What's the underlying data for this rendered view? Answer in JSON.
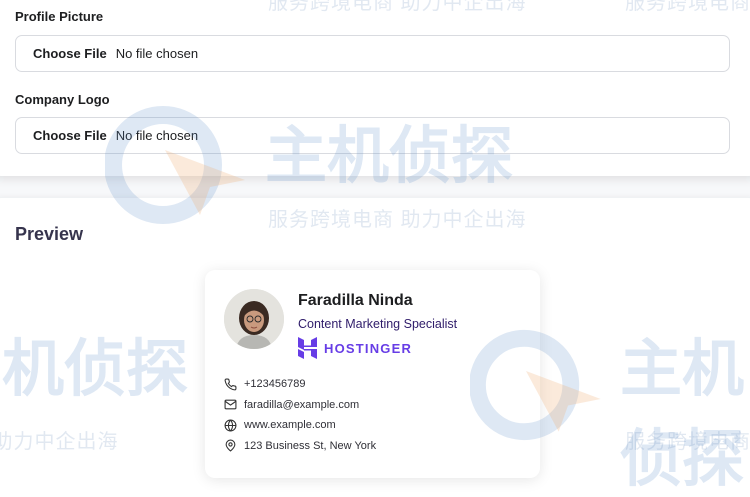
{
  "form": {
    "profile_picture": {
      "label": "Profile Picture",
      "button": "Choose File",
      "status": "No file chosen"
    },
    "company_logo": {
      "label": "Company Logo",
      "button": "Choose File",
      "status": "No file chosen"
    }
  },
  "preview": {
    "title": "Preview",
    "signature": {
      "name": "Faradilla Ninda",
      "role": "Content Marketing Specialist",
      "company": "HOSTINGER",
      "brand_color": "#673de6",
      "contacts": [
        {
          "icon": "phone-icon",
          "text": "+123456789"
        },
        {
          "icon": "mail-icon",
          "text": "faradilla@example.com"
        },
        {
          "icon": "globe-icon",
          "text": "www.example.com"
        },
        {
          "icon": "location-pin-icon",
          "text": "123 Business St, New York"
        }
      ]
    }
  },
  "watermark": {
    "brand": "主机侦探",
    "slogan": "服务跨境电商 助力中企出海"
  }
}
